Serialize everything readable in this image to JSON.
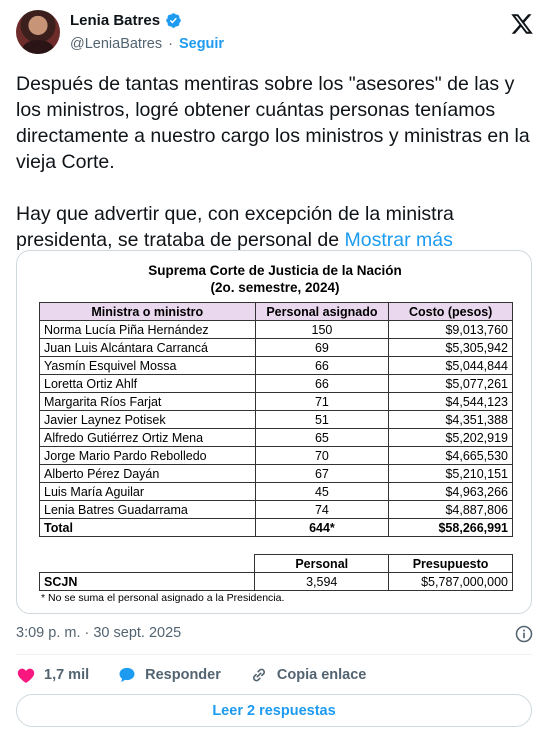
{
  "author": {
    "name": "Lenia Batres",
    "handle": "@LeniaBatres",
    "separator": "·",
    "follow_label": "Seguir"
  },
  "tweet": {
    "paragraph1": "Después de tantas mentiras sobre los \"asesores\" de las y los ministros, logré obtener cuántas personas teníamos directamente a nuestro cargo los ministros y ministras en la vieja Corte.",
    "paragraph2": "Hay que advertir que, con excepción de la ministra presidenta, se trataba de personal de",
    "show_more": "Mostrar más"
  },
  "image_table": {
    "title": "Suprema Corte de Justicia de la Nación",
    "subtitle": "(2o. semestre, 2024)",
    "headers": [
      "Ministra o ministro",
      "Personal asignado",
      "Costo (pesos)"
    ],
    "rows": [
      [
        "Norma Lucía Piña Hernández",
        "150",
        "$9,013,760"
      ],
      [
        "Juan Luis Alcántara Carrancá",
        "69",
        "$5,305,942"
      ],
      [
        "Yasmín Esquivel Mossa",
        "66",
        "$5,044,844"
      ],
      [
        "Loretta Ortiz Ahlf",
        "66",
        "$5,077,261"
      ],
      [
        "Margarita Ríos Farjat",
        "71",
        "$4,544,123"
      ],
      [
        "Javier Laynez Potisek",
        "51",
        "$4,351,388"
      ],
      [
        "Alfredo Gutiérrez Ortiz Mena",
        "65",
        "$5,202,919"
      ],
      [
        "Jorge Mario Pardo Rebolledo",
        "70",
        "$4,665,530"
      ],
      [
        "Alberto Pérez Dayán",
        "67",
        "$5,210,151"
      ],
      [
        "Luis María Aguilar",
        "45",
        "$4,963,266"
      ],
      [
        "Lenia Batres Guadarrama",
        "74",
        "$4,887,806"
      ]
    ],
    "total": [
      "Total",
      "644*",
      "$58,266,991"
    ],
    "summary_headers": [
      "Personal",
      "Presupuesto"
    ],
    "summary_row": [
      "SCJN",
      "3,594",
      "$5,787,000,000"
    ],
    "footnote": "* No se suma el personal asignado a la Presidencia."
  },
  "meta": {
    "timestamp": "3:09 p. m. · 30 sept. 2025"
  },
  "actions": {
    "likes": "1,7 mil",
    "reply_label": "Responder",
    "copy_label": "Copia enlace"
  },
  "replies_button": "Leer 2 respuestas",
  "colors": {
    "accent": "#1d9bf0",
    "like": "#f91880",
    "header_fill": "#ead8ee",
    "muted": "#536471"
  },
  "icons": [
    "verified-badge-icon",
    "x-logo-icon",
    "info-icon",
    "heart-icon",
    "reply-bubble-icon",
    "link-icon"
  ]
}
